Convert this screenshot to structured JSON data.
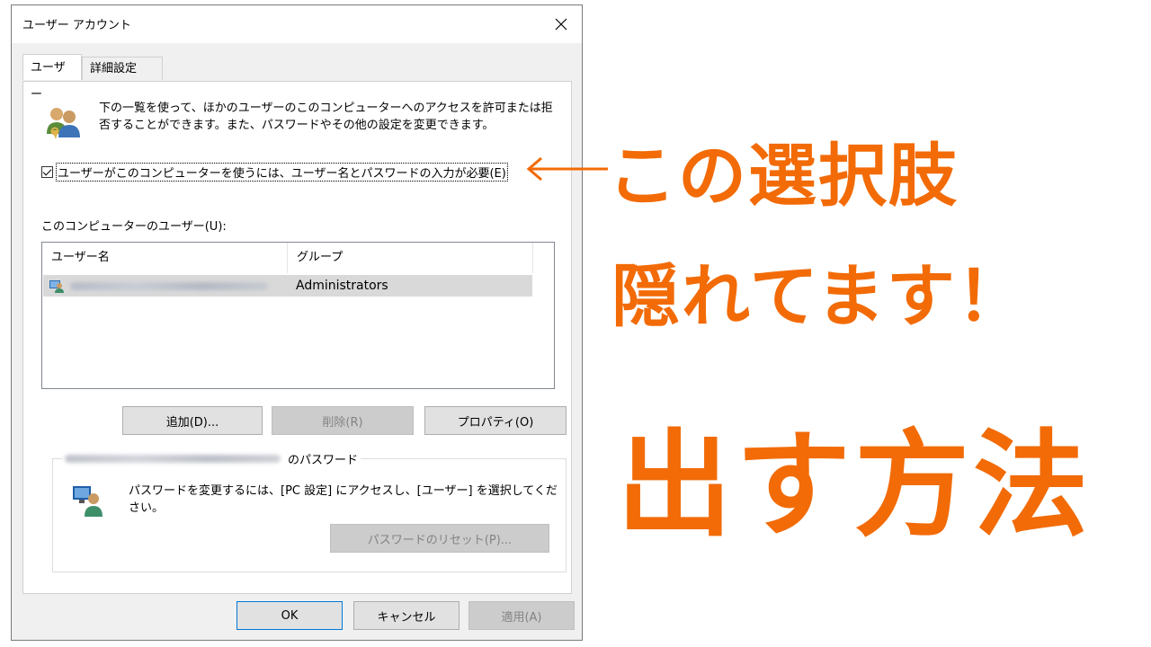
{
  "window": {
    "title": "ユーザー アカウント"
  },
  "tabs": [
    {
      "label": "ユーザー",
      "active": true
    },
    {
      "label": "詳細設定",
      "active": false
    }
  ],
  "intro": {
    "text": "下の一覧を使って、ほかのユーザーのこのコンピューターへのアクセスを許可または拒否することができます。また、パスワードやその他の設定を変更できます。"
  },
  "require_login": {
    "label": "ユーザーがこのコンピューターを使うには、ユーザー名とパスワードの入力が必要(E)",
    "checked": true
  },
  "users_section": {
    "label": "このコンピューターのユーザー(U):"
  },
  "users_table": {
    "columns": [
      "ユーザー名",
      "グループ"
    ],
    "rows": [
      {
        "name": "(blurred)",
        "group": "Administrators"
      }
    ]
  },
  "buttons": {
    "add": "追加(D)...",
    "remove": "削除(R)",
    "properties": "プロパティ(O)",
    "reset_password": "パスワードのリセット(P)...",
    "ok": "OK",
    "cancel": "キャンセル",
    "apply": "適用(A)"
  },
  "password_group": {
    "legend_suffix": "のパスワード",
    "text": "パスワードを変更するには、[PC 設定] にアクセスし、[ユーザー] を選択してください。"
  },
  "annotation": {
    "line1": "この選択肢",
    "line2": "隠れてます！",
    "line3": "出す方法",
    "color": "#f26b07"
  },
  "icons": {
    "close": "close-icon",
    "users": "users-icon",
    "user_row": "user-account-icon",
    "password": "user-monitor-icon",
    "arrow": "left-arrow-icon"
  }
}
